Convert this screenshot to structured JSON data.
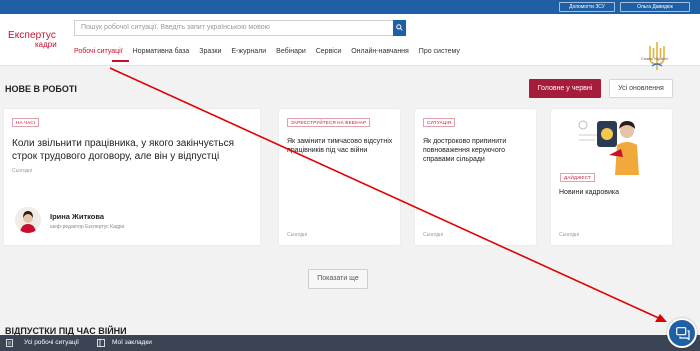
{
  "topbar": {
    "support_label": "Допомогти ЗСУ",
    "user_label": "Ольга Давидюк"
  },
  "header": {
    "logo_line1": "Експертус",
    "logo_line2": "кадри",
    "search_placeholder": "Пошук робочої ситуації. Введіть запит українською мовою",
    "nav": [
      "Робочі ситуації",
      "Нормативна база",
      "Зразки",
      "Е-журнали",
      "Вебінари",
      "Сервіси",
      "Онлайн-навчання",
      "Про систему"
    ],
    "emblem_caption": "Слава Україні!"
  },
  "main": {
    "section_title": "НОВЕ В РОБОТІ",
    "btn_primary": "Головне у червні",
    "btn_secondary": "Усі оновлення",
    "cards": [
      {
        "badge": "НА ЧАСІ",
        "title": "Коли звільнити працівника, у якого закінчується строк трудового договору, але він у відпустці",
        "date": "Сьогодні",
        "author_name": "Ірина Житкова",
        "author_role": "шеф-редактор Експертус Кадри"
      },
      {
        "badge": "ЗАРЕЄСТРУЙТЕСЯ НА ВЕБІНАР",
        "title": "Як замінити тимчасово відсутніх працівників під час війни",
        "date": "Сьогодні"
      },
      {
        "badge": "СИТУАЦІЯ",
        "title": "Як достроково припинити повноваження керуючого справами сільради",
        "date": "Сьогодні"
      },
      {
        "badge": "ДАЙДЖЕСТ",
        "title": "Новини кадровика",
        "date": "Сьогодні"
      }
    ],
    "show_more": "Показати ще",
    "section2_title": "ВІДПУСТКИ ПІД ЧАС ВІЙНИ"
  },
  "bottombar": {
    "item1": "Усі робочі ситуації",
    "item2": "Мої закладки"
  },
  "colors": {
    "brand_red": "#c8102e",
    "brand_blue": "#1f5fa3",
    "button_red": "#a41e3b"
  }
}
